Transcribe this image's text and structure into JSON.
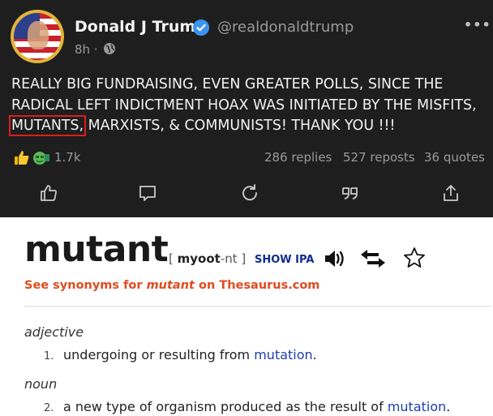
{
  "post": {
    "author_name": "Donald J Trump",
    "handle": "@realdonaldtrump",
    "time": "8h",
    "more": "•••",
    "text_before": "REALLY BIG FUNDRAISING, EVEN GREATER POLLS, SINCE THE RADICAL LEFT INDICTMENT HOAX WAS INITIATED BY THE MISFITS, ",
    "text_highlight": "MUTANTS,",
    "text_after": " MARXISTS, & COMMUNISTS! THANK YOU !!!",
    "highlight_color": "#e01b1b",
    "reaction_count": "1.7k",
    "replies": "286 replies",
    "reposts": "527 reposts",
    "quotes": "36 quotes",
    "actions": [
      "like-icon",
      "comment-icon",
      "repost-icon",
      "quote-icon",
      "share-icon"
    ]
  },
  "dictionary": {
    "headword": "mutant",
    "pron_open": "[ ",
    "pron_stress": "myoot",
    "pron_rest": "-nt ]",
    "show_ipa": "SHOW IPA",
    "synonyms_prefix": "See synonyms for ",
    "synonyms_word": "mutant",
    "synonyms_suffix": " on Thesaurus.com",
    "entries": [
      {
        "pos": "adjective",
        "num": "1.",
        "def": "undergoing or resulting from ",
        "link": "mutation",
        "end": "."
      },
      {
        "pos": "noun",
        "num": "2.",
        "def": "a new type of organism produced as the result of ",
        "link": "mutation",
        "end": "."
      }
    ],
    "colors": {
      "link": "#1f3fa8",
      "synonyms": "#e14a1f",
      "ipa": "#0f2c90"
    }
  }
}
